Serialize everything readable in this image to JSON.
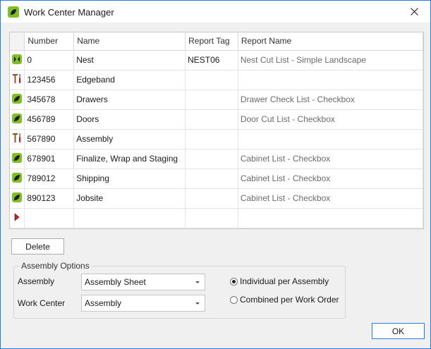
{
  "window": {
    "title": "Work Center Manager"
  },
  "grid": {
    "columns": [
      "Number",
      "Name",
      "Report Tag",
      "Report Name"
    ],
    "rows": [
      {
        "icon": "nest-icon",
        "number": "0",
        "name": "Nest",
        "report_tag": "NEST06",
        "report_name": "Nest Cut List - Simple Landscape"
      },
      {
        "icon": "tools-icon",
        "number": "123456",
        "name": "Edgeband",
        "report_tag": "",
        "report_name": ""
      },
      {
        "icon": "leaf-icon",
        "number": "345678",
        "name": "Drawers",
        "report_tag": "",
        "report_name": "Drawer Check List - Checkbox"
      },
      {
        "icon": "leaf-icon",
        "number": "456789",
        "name": "Doors",
        "report_tag": "",
        "report_name": "Door Cut List - Checkbox"
      },
      {
        "icon": "tools-icon",
        "number": "567890",
        "name": "Assembly",
        "report_tag": "",
        "report_name": ""
      },
      {
        "icon": "leaf-icon",
        "number": "678901",
        "name": "Finalize, Wrap and Staging",
        "report_tag": "",
        "report_name": "Cabinet List - Checkbox"
      },
      {
        "icon": "leaf-icon",
        "number": "789012",
        "name": "Shipping",
        "report_tag": "",
        "report_name": "Cabinet List - Checkbox"
      },
      {
        "icon": "leaf-icon",
        "number": "890123",
        "name": "Jobsite",
        "report_tag": "",
        "report_name": "Cabinet List - Checkbox"
      }
    ]
  },
  "delete_label": "Delete",
  "assembly_options": {
    "title": "Assembly Options",
    "assembly_label": "Assembly",
    "assembly_value": "Assembly Sheet",
    "work_center_label": "Work Center",
    "work_center_value": "Assembly",
    "radio_individual": "Individual per Assembly",
    "radio_combined": "Combined per Work Order",
    "selected": "individual"
  },
  "ok_label": "OK",
  "colors": {
    "accent": "#2b79d8",
    "leaf_green": "#7fbf2a",
    "new_row_marker": "#d11b1b"
  }
}
